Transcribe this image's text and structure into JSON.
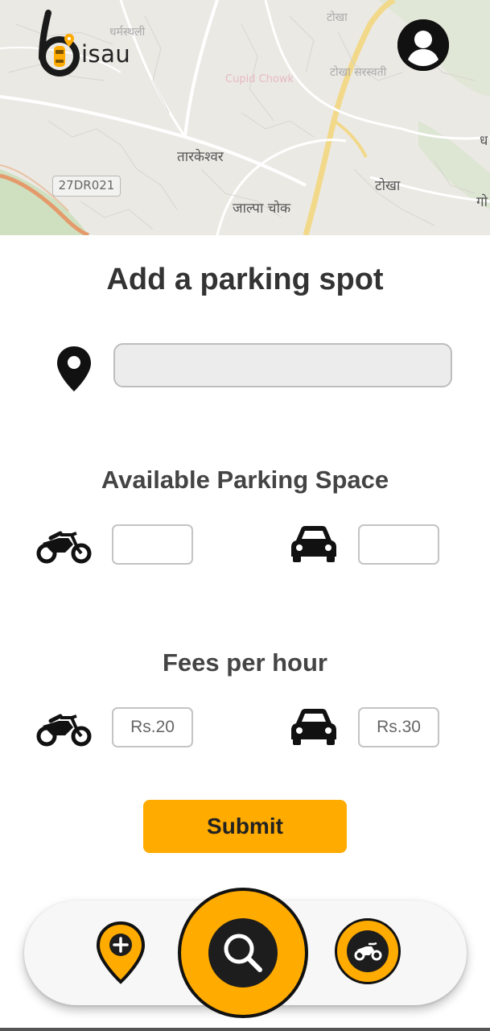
{
  "app": {
    "logo_text": "isau"
  },
  "map": {
    "labels": {
      "tarkeshwar": "तारकेश्वर",
      "jalpa_chowk": "जाल्पा चोक",
      "tokha": "टोखा",
      "tokha_saraswati": "टोखा सरस्वती",
      "top_partial": "टोखा",
      "dharmasthali": "धर्मस्थली",
      "cupid_chowk": "Cupid Chowk",
      "right_edge_1": "ध",
      "right_edge_2": "गो"
    },
    "road_badge": "27DR021"
  },
  "page": {
    "title": "Add a parking spot",
    "location_value": "",
    "available_title": "Available Parking Space",
    "bike_space_value": "",
    "car_space_value": "",
    "fees_title": "Fees per hour",
    "bike_fee_placeholder": "Rs.20",
    "car_fee_placeholder": "Rs.30",
    "submit_label": "Submit"
  },
  "icons": {
    "profile": "user-circle-icon",
    "location": "map-pin-icon",
    "bike": "motorcycle-icon",
    "car": "car-icon",
    "nav_add": "add-location-icon",
    "nav_search": "search-icon",
    "nav_bike": "motorcycle-icon"
  },
  "colors": {
    "accent": "#ffab00",
    "dark": "#111111",
    "input_bg": "#ececec",
    "text": "#333333"
  }
}
